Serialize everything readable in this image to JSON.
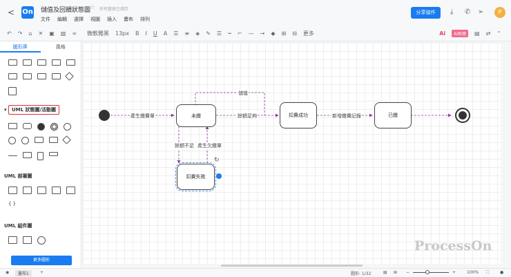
{
  "header": {
    "back": "<",
    "logo": "On",
    "title": "儲值及回饋狀態圖",
    "star": "☆",
    "saved": "所有變更已儲存",
    "menu": [
      "文件",
      "編輯",
      "選擇",
      "視圖",
      "插入",
      "畫布",
      "排列"
    ],
    "share": "分享協作",
    "avatar": "P"
  },
  "toolbar": {
    "font": "微軟雅黑",
    "font_size": "13px",
    "more": "更多",
    "ai": "Ai",
    "ai_badge": "AI助理"
  },
  "sidebar": {
    "tabs": [
      "圖形庫",
      "風格"
    ],
    "sections": [
      "UML 狀態圖/活動圖",
      "UML 部署圖",
      "UML 組件圖"
    ],
    "braces": "{ }",
    "more_button": "更多圖形"
  },
  "diagram": {
    "nodes": [
      "未繳",
      "扣費成功",
      "已繳",
      "扣費失敗"
    ],
    "edges": [
      "產生繳費單",
      "餘額足夠",
      "儲值",
      "新增繳費記錄",
      "餘額不足",
      "產生欠繳單"
    ]
  },
  "watermark": "ProcessOn",
  "status": {
    "page_tab": "畫布1",
    "add": "+",
    "shapes": "圖形: 1/32",
    "zoom": "100%"
  },
  "colors": {
    "accent": "#1a7cf0",
    "edge": "#8a3a9a"
  }
}
